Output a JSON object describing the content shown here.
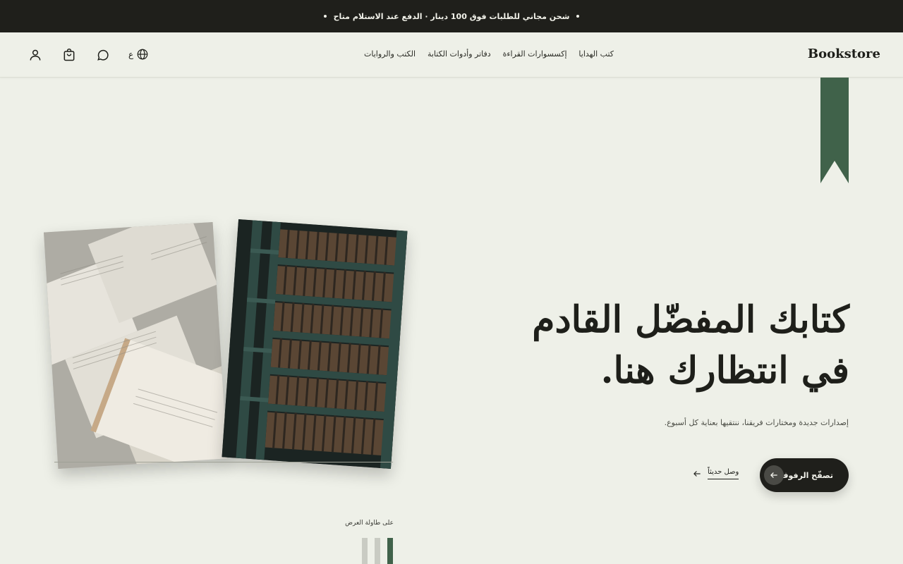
{
  "announcement": {
    "text": "شحن مجاني للطلبات فوق 100 دينار · الدفع عند الاستلام متاح"
  },
  "header": {
    "logo": "Bookstore",
    "nav": [
      {
        "label": "الكتب والروايات"
      },
      {
        "label": "دفاتر وأدوات الكتابة"
      },
      {
        "label": "إكسسوارات القراءة"
      },
      {
        "label": "كتب الهدايا"
      }
    ],
    "language_label": "ع",
    "icons": [
      "globe-icon",
      "chat-icon",
      "cart-icon",
      "user-icon"
    ]
  },
  "hero": {
    "title_line1": "كتابك المفضّل القادم",
    "title_line2": "في انتظارك هنا.",
    "subtitle": "إصدارات جديدة ومختارات فريقنا، ننتقيها بعناية كل أسبوع.",
    "cta_label": "تصفّح الرفوف",
    "secondary_link": "وصل حديثاً"
  },
  "display": {
    "label": "على طاولة العرض"
  },
  "colors": {
    "background": "#eef0e8",
    "dark": "#1f1f1b",
    "accent_green": "#40624a",
    "spine_gray": "#c9cbc3"
  }
}
